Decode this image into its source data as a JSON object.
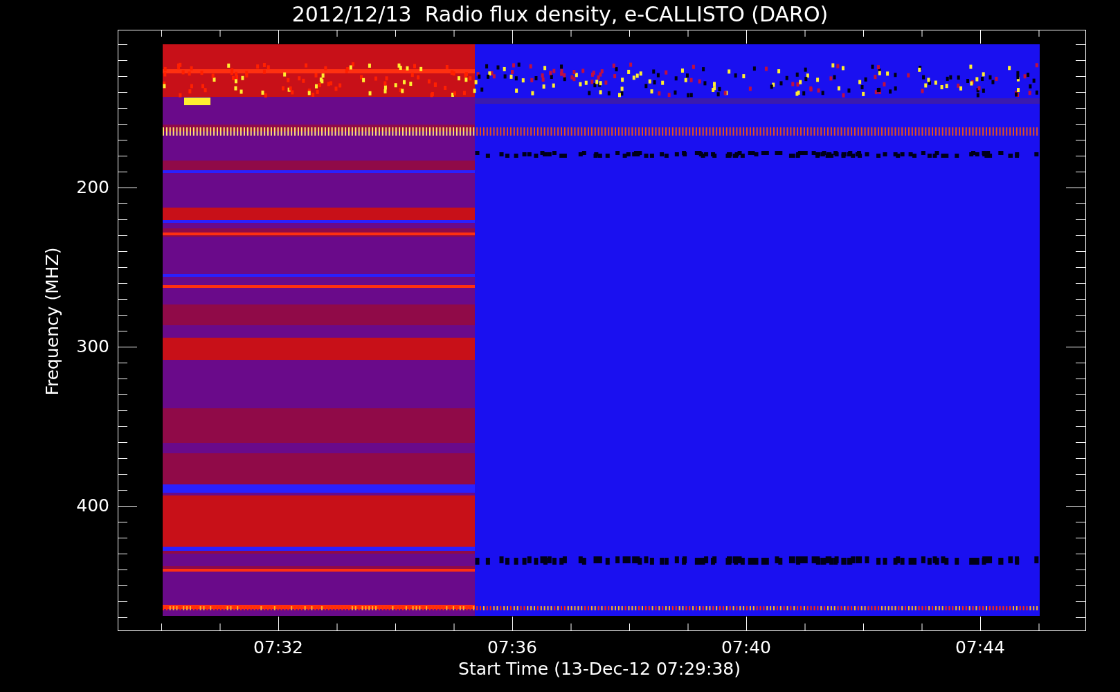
{
  "title": "2012/12/13  Radio flux density, e-CALLISTO (DARO)",
  "y_axis": {
    "label": "Frequency (MHZ)",
    "ticks": [
      "200",
      "300",
      "400"
    ]
  },
  "x_axis": {
    "label": "Start Time (13-Dec-12 07:29:38)",
    "ticks": [
      "07:32",
      "07:36",
      "07:40",
      "07:44"
    ]
  }
}
